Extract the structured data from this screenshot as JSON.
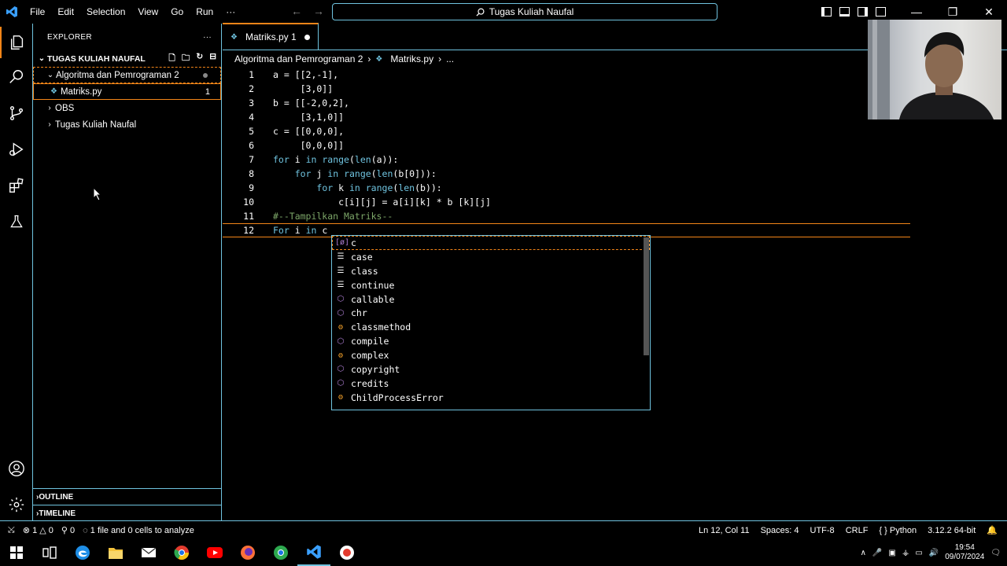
{
  "menu": [
    "File",
    "Edit",
    "Selection",
    "View",
    "Go",
    "Run"
  ],
  "menu_more": "···",
  "search_box": "Tugas Kuliah Naufal",
  "window_controls": {
    "minimize": "—",
    "restore": "❐",
    "close": "✕"
  },
  "explorer": {
    "title": "EXPLORER",
    "more": "···",
    "root": "TUGAS KULIAH NAUFAL",
    "folder": "Algoritma dan Pemrograman 2",
    "file": "Matriks.py",
    "file_badge": "1",
    "items": [
      "OBS",
      "Tugas Kuliah Naufal"
    ],
    "outline": "OUTLINE",
    "timeline": "TIMELINE"
  },
  "tab": {
    "label": "Matriks.py 1"
  },
  "breadcrumb": {
    "folder": "Algoritma dan Pemrograman 2",
    "file": "Matriks.py",
    "tail": "..."
  },
  "code_lines": [
    {
      "n": "1",
      "text": "a = [[2,-1],"
    },
    {
      "n": "2",
      "text": "     [3,0]]"
    },
    {
      "n": "3",
      "text": "b = [[-2,0,2],"
    },
    {
      "n": "4",
      "text": "     [3,1,0]]"
    },
    {
      "n": "5",
      "text": "c = [[0,0,0],"
    },
    {
      "n": "6",
      "text": "     [0,0,0]]"
    },
    {
      "n": "7",
      "text": "for i in range(len(a)):"
    },
    {
      "n": "8",
      "text": "    for j in range(len(b[0])):"
    },
    {
      "n": "9",
      "text": "        for k in range(len(b)):"
    },
    {
      "n": "10",
      "text": "            c[i][j] = a[i][k] * b [k][j]"
    },
    {
      "n": "11",
      "text": "#--Tampilkan Matriks--"
    },
    {
      "n": "12",
      "text": "For i in c"
    }
  ],
  "suggestions": [
    {
      "label": "c",
      "kind": "var"
    },
    {
      "label": "case",
      "kind": "kw"
    },
    {
      "label": "class",
      "kind": "kw"
    },
    {
      "label": "continue",
      "kind": "kw"
    },
    {
      "label": "callable",
      "kind": "fn"
    },
    {
      "label": "chr",
      "kind": "fn"
    },
    {
      "label": "classmethod",
      "kind": "cls"
    },
    {
      "label": "compile",
      "kind": "fn"
    },
    {
      "label": "complex",
      "kind": "cls"
    },
    {
      "label": "copyright",
      "kind": "fn"
    },
    {
      "label": "credits",
      "kind": "fn"
    },
    {
      "label": "ChildProcessError",
      "kind": "cls"
    }
  ],
  "status": {
    "errors": "1",
    "warnings": "0",
    "ports": "0",
    "analyze": "1 file and 0 cells to analyze",
    "position": "Ln 12, Col 11",
    "spaces": "Spaces: 4",
    "encoding": "UTF-8",
    "eol": "CRLF",
    "language": "Python",
    "interpreter": "3.12.2 64-bit"
  },
  "clock": {
    "time": "19:54",
    "date": "09/07/2024"
  },
  "colors": {
    "accent_border": "#6fc3df",
    "focus_orange": "#f38518",
    "background": "#000000"
  }
}
